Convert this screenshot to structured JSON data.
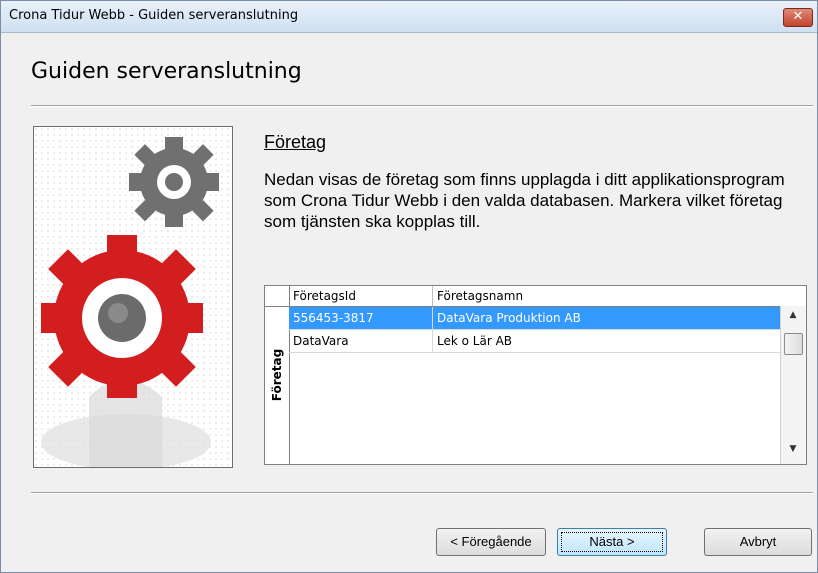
{
  "window": {
    "title": "Crona Tidur Webb - Guiden serveranslutning",
    "close_label": "✕"
  },
  "wizard": {
    "heading": "Guiden serveranslutning",
    "section_title": "Företag",
    "description": "Nedan visas de företag som finns upplagda i ditt applikationsprogram som Crona Tidur Webb i den valda databasen. Markera vilket företag som tjänsten ska kopplas till."
  },
  "grid": {
    "side_label": "Företag",
    "columns": [
      "FöretagsId",
      "Företagsnamn"
    ],
    "rows": [
      {
        "id": "556453-3817",
        "name": "DataVara Produktion AB",
        "selected": true
      },
      {
        "id": "DataVara",
        "name": "Lek o Lär AB",
        "selected": false
      }
    ],
    "scroll_up_icon": "▲",
    "scroll_down_icon": "▼"
  },
  "buttons": {
    "back": "< Föregående",
    "next": "Nästa >",
    "cancel": "Avbryt"
  },
  "colors": {
    "selection": "#3399ff",
    "gear_red": "#d21e1e",
    "gear_gray": "#707070"
  }
}
